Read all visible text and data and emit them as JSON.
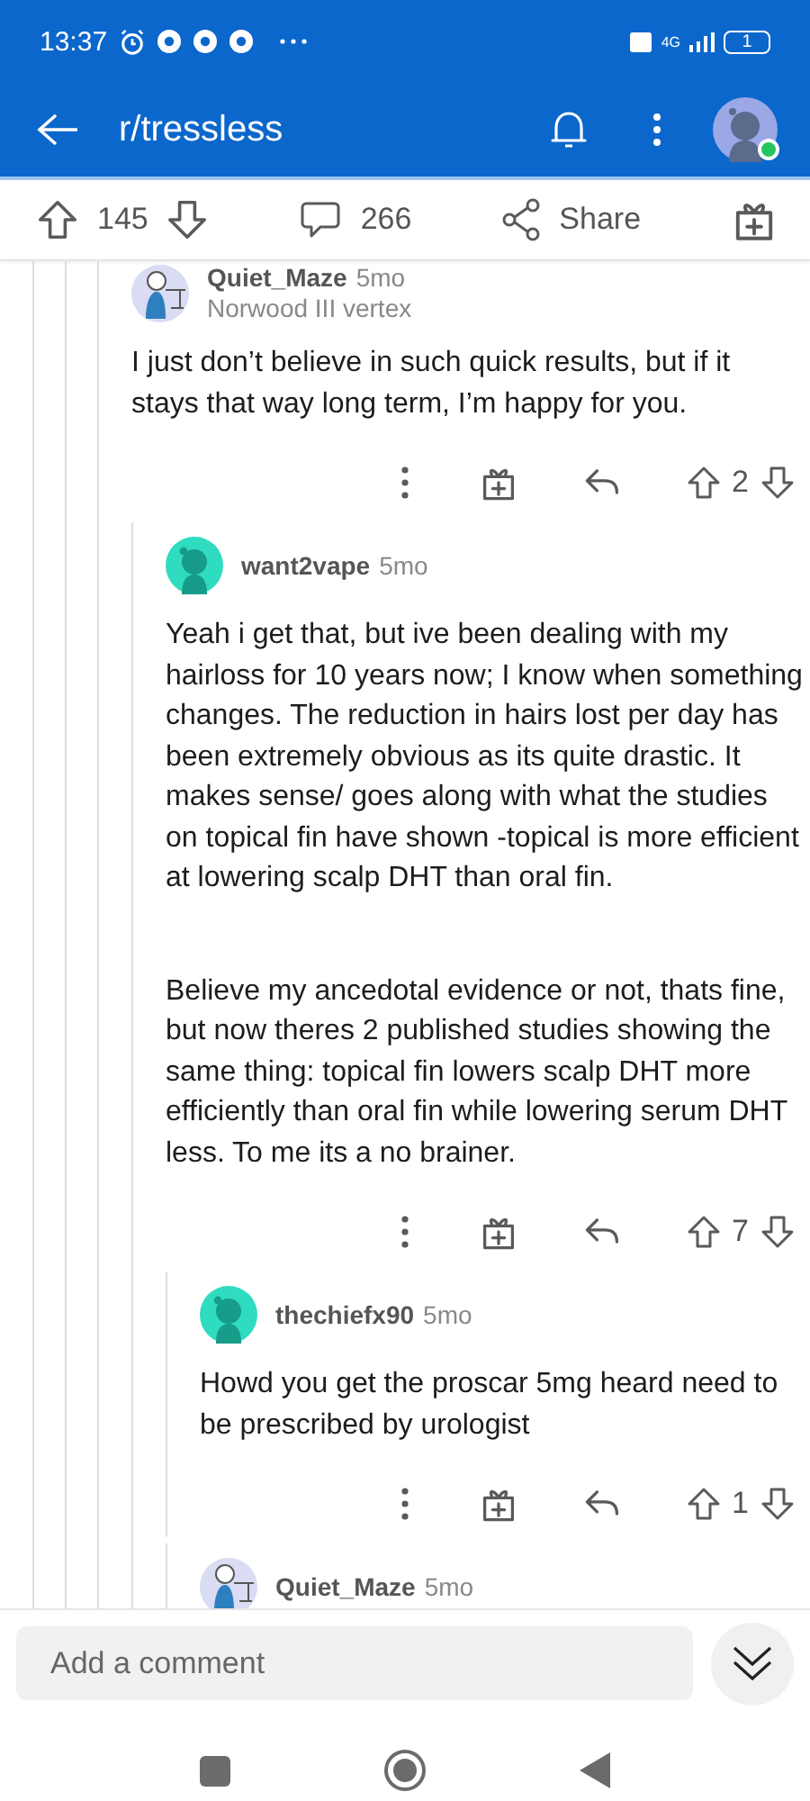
{
  "status_bar": {
    "time": "13:37",
    "network": "4G",
    "battery": "1"
  },
  "header": {
    "title": "r/tressless",
    "online": true
  },
  "post_actions": {
    "votes": "145",
    "comments": "266",
    "share": "Share"
  },
  "comments": [
    {
      "author": "Quiet_Maze",
      "age": "5mo",
      "flair": "Norwood III vertex",
      "avatar": {
        "kind": "figure"
      },
      "paragraphs": [
        "I just don’t believe in such quick results, but if it stays that way long term, I’m happy for you."
      ],
      "votes": "2",
      "children": [
        {
          "author": "want2vape",
          "age": "5mo",
          "avatar": {
            "kind": "silhouette"
          },
          "paragraphs": [
            "Yeah i get that, but ive been dealing with my hairloss for 10 years now; I know when something changes. The reduction in hairs lost per day has been extremely obvious as its quite drastic. It makes sense/ goes along with what the studies on topical fin have shown -topical is more efficient at lowering scalp DHT than oral fin.",
            "Believe my ancedotal evidence or not, thats fine, but now theres 2 published studies showing the same thing: topical fin lowers scalp DHT more efficiently than oral fin while lowering serum DHT less. To me its a no brainer."
          ],
          "votes": "7",
          "children": [
            {
              "author": "thechiefx90",
              "age": "5mo",
              "avatar": {
                "kind": "silhouette"
              },
              "paragraphs": [
                "Howd you get the proscar 5mg heard need to be prescribed by urologist"
              ],
              "votes": "1"
            },
            {
              "author": "Quiet_Maze",
              "age": "5mo",
              "avatar": {
                "kind": "figure"
              }
            }
          ]
        }
      ]
    }
  ],
  "composer": {
    "placeholder": "Add a comment"
  }
}
